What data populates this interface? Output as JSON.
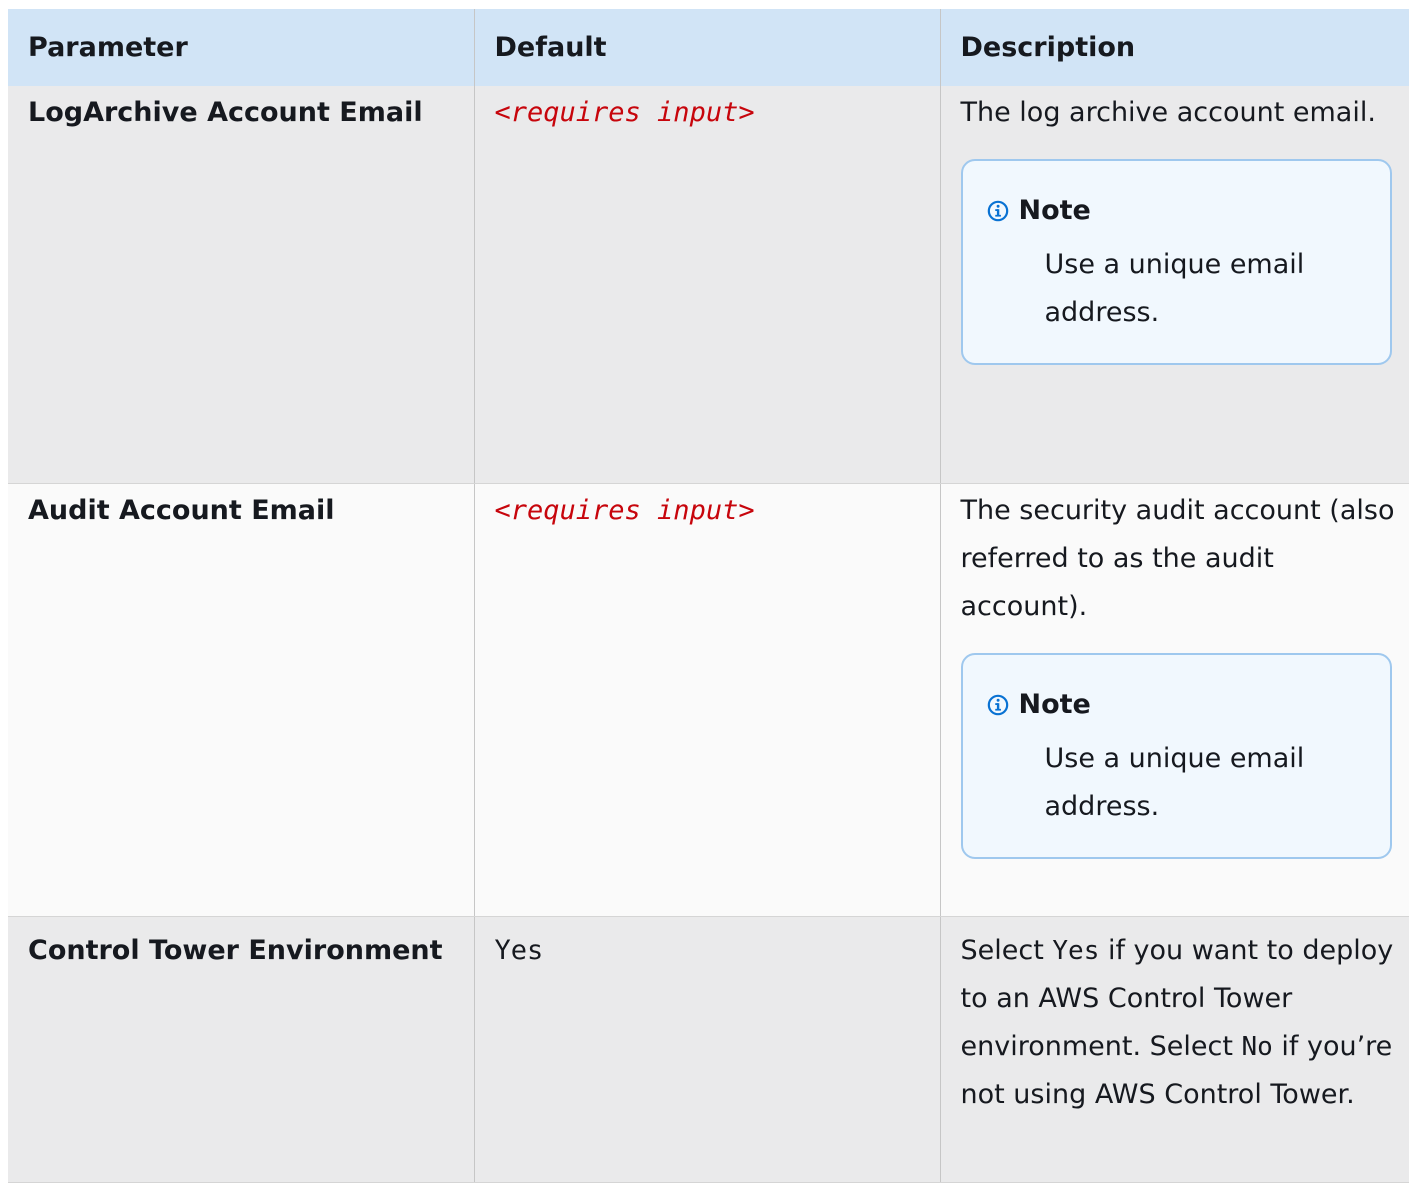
{
  "header": {
    "parameter": "Parameter",
    "default": "Default",
    "description": "Description"
  },
  "rows": [
    {
      "parameter": "LogArchive Account Email",
      "default": "<requires input>",
      "description": "The log archive account email.",
      "note": {
        "title": "Note",
        "text": "Use a unique email address."
      }
    },
    {
      "parameter": "Audit Account Email",
      "default": "<requires input>",
      "description": "The security audit account (also referred to as the audit account).",
      "note": {
        "title": "Note",
        "text": "Use a unique email address."
      }
    },
    {
      "parameter": "Control Tower Environment",
      "default": "Yes",
      "description_parts": {
        "p1": "Select ",
        "code1": "Yes",
        "p2": " if you want to deploy to an AWS Control Tower environment. Select ",
        "code2": "No",
        "p3": " if you’re not using AWS Control Tower."
      }
    }
  ],
  "colors": {
    "header_bg": "#d1e4f6",
    "row_grey": "#eaeaeb",
    "row_white": "#fafafa",
    "placeholder_red": "#c7050c",
    "note_border": "#9fc8ee",
    "note_bg": "#f1f8fe",
    "info_icon": "#0972d3"
  },
  "icons": {
    "note_icon": "info-circle-icon"
  }
}
